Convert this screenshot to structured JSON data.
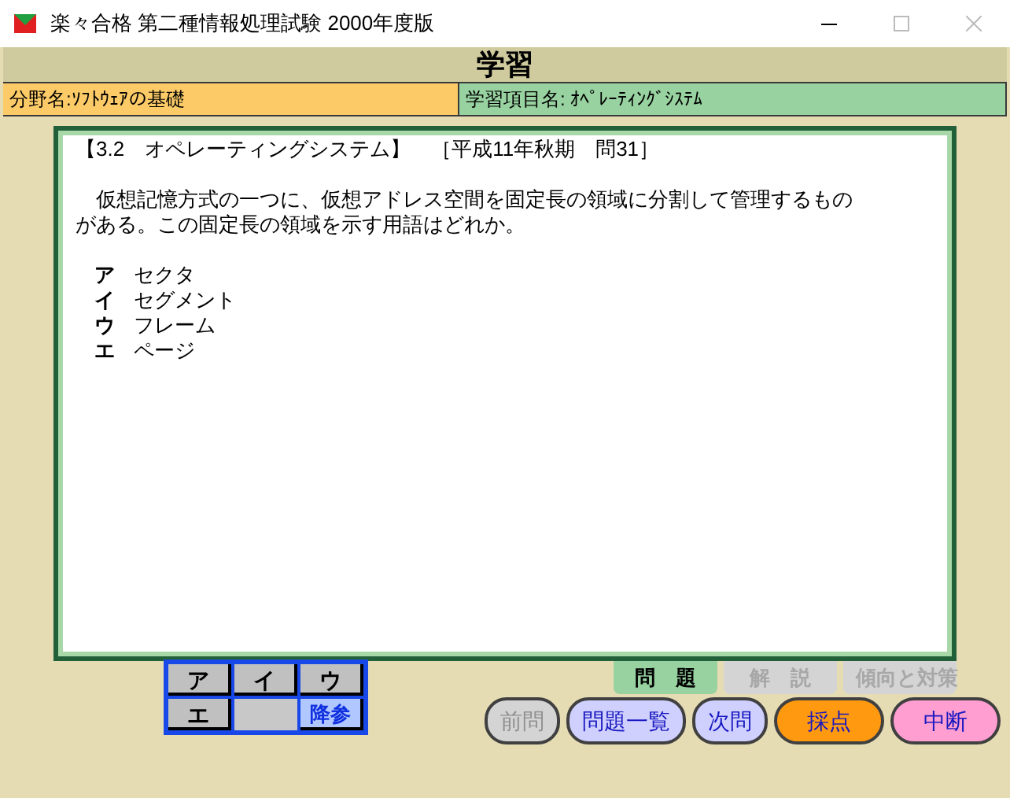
{
  "window": {
    "title": "楽々合格 第二種情報処理試験 2000年度版"
  },
  "header": {
    "title": "学習"
  },
  "fields": [
    {
      "label": "分野名:ｿﾌﾄｳｪｱの基礎",
      "color": "#fccb68"
    },
    {
      "label": "学習項目名: ｵﾍﾟﾚｰﾃｨﾝｸﾞｼｽﾃﾑ",
      "color": "#98d2a0"
    }
  ],
  "question": {
    "heading": "【3.2　オペレーティングシステム】　［平成11年秋期　問31］",
    "body": "　仮想記憶方式の一つに、仮想アドレス空間を固定長の領域に分割して管理するものがある。この固定長の領域を示す用語はどれか。",
    "choices": [
      {
        "mark": "ア",
        "text": "セクタ"
      },
      {
        "mark": "イ",
        "text": "セグメント"
      },
      {
        "mark": "ウ",
        "text": "フレーム"
      },
      {
        "mark": "エ",
        "text": "ページ"
      }
    ]
  },
  "tabs": [
    {
      "label": "問　題",
      "selected": true,
      "disabled": false
    },
    {
      "label": "解　説",
      "selected": false,
      "disabled": true
    },
    {
      "label": "傾向と対策",
      "selected": false,
      "disabled": true
    }
  ],
  "answer_buttons": [
    {
      "label": "ア",
      "kind": "answer"
    },
    {
      "label": "イ",
      "kind": "answer"
    },
    {
      "label": "ウ",
      "kind": "answer"
    },
    {
      "label": "エ",
      "kind": "answer"
    },
    {
      "kind": "blank"
    },
    {
      "label": "降参",
      "kind": "giveup"
    }
  ],
  "nav_buttons": [
    {
      "label": "前問",
      "color": "#d4d4d4",
      "disabled": true
    },
    {
      "label": "問題一覧",
      "color": "#d0d0ff",
      "disabled": false
    },
    {
      "label": "次問",
      "color": "#d0d0ff",
      "disabled": false
    },
    {
      "label": "採点",
      "color": "#ff9a10",
      "disabled": false
    },
    {
      "label": "中断",
      "color": "#ff9ed0",
      "disabled": false
    }
  ]
}
